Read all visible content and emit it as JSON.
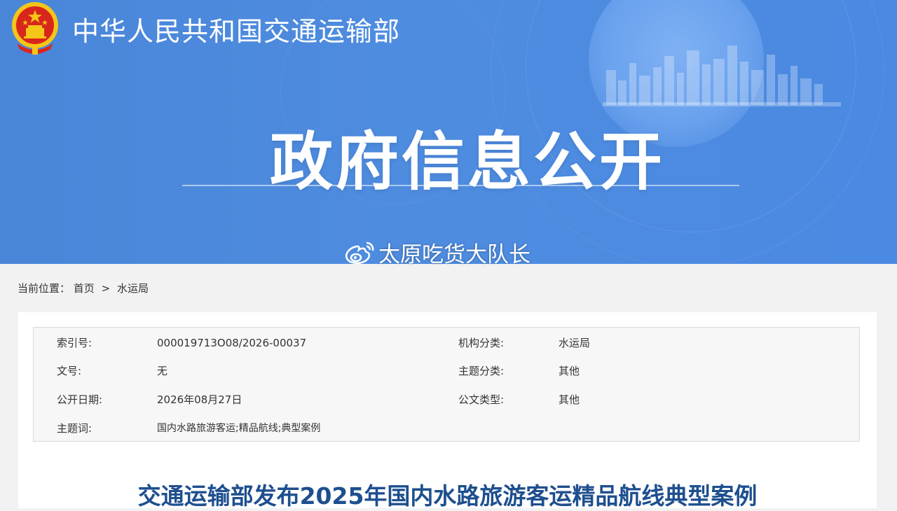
{
  "header": {
    "ministry_name": "中华人民共和国交通运输部",
    "section_title": "政府信息公开"
  },
  "watermark": {
    "icon": "weibo-icon",
    "text": "太原吃货大队长"
  },
  "breadcrumb": {
    "prefix": "当前位置：",
    "items": [
      "首页",
      "水运局"
    ],
    "separator": ">"
  },
  "meta": {
    "rows": [
      {
        "k1": "索引号:",
        "v1": "000019713O08/2026-00037",
        "k2": "机构分类:",
        "v2": "水运局"
      },
      {
        "k1": "文号:",
        "v1": "无",
        "k2": "主题分类:",
        "v2": "其他"
      },
      {
        "k1": "公开日期:",
        "v1": "2026年08月27日",
        "k2": "公文类型:",
        "v2": "其他"
      },
      {
        "k1": "主题词:",
        "v1": "国内水路旅游客运;精品航线;典型案例"
      }
    ]
  },
  "article": {
    "title": "交通运输部发布2025年国内水路旅游客运精品航线典型案例"
  },
  "colors": {
    "banner": "#4e8ce0",
    "title_blue": "#1e4f8f",
    "emblem_red": "#d9261c",
    "emblem_gold": "#f5c518"
  }
}
